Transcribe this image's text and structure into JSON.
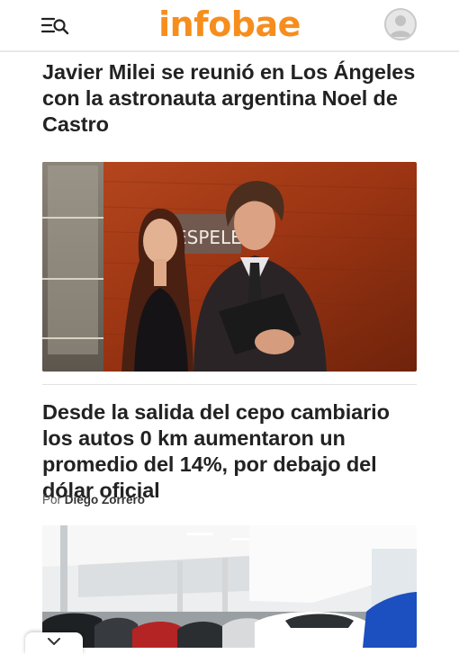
{
  "header": {
    "logo": "infobae",
    "menu_icon": "menu-search-icon",
    "user_icon": "user-avatar-icon",
    "brand_color": "#f68e1e"
  },
  "articles": [
    {
      "title": "Javier Milei se reunió en Los Ángeles con la astronauta argentina Noel de Castro",
      "photo_sign": "ESPELE"
    },
    {
      "title": "Desde la salida del cepo cambiario los autos 0 km aumentaron un promedio del 14%, por debajo del dólar oficial",
      "byline_prefix": "Por",
      "author": "Diego Zorrero"
    }
  ],
  "bottom_bar": {
    "close_icon": "chevron-down-icon"
  }
}
